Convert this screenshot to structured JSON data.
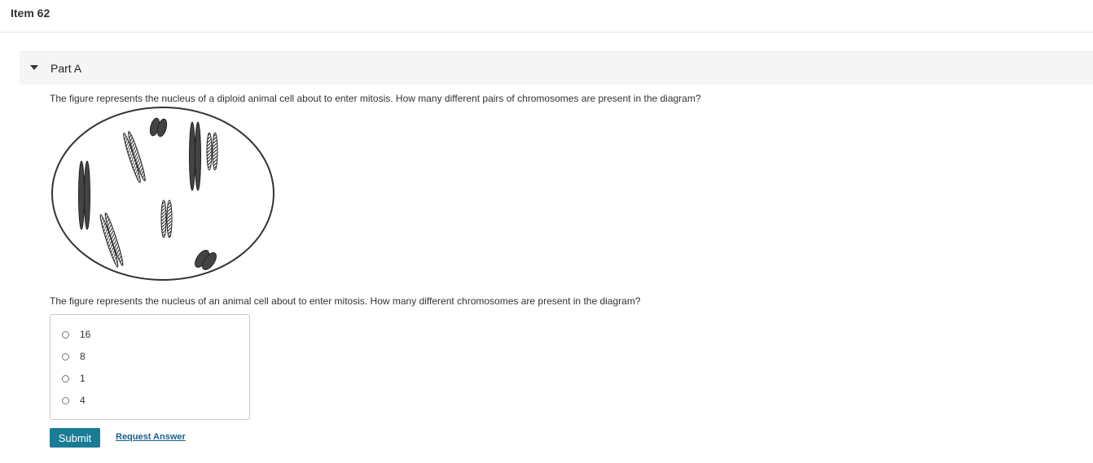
{
  "item": {
    "title": "Item 62"
  },
  "part": {
    "label": "Part A"
  },
  "question": {
    "text1": "The figure represents the nucleus of a diploid animal cell about to enter mitosis. How many different pairs of chromosomes are present in the diagram?",
    "text2": "The figure represents the nucleus of an animal cell about to enter mitosis. How many different chromosomes are present in the diagram?"
  },
  "choices": [
    {
      "label": "16",
      "selected": false
    },
    {
      "label": "8",
      "selected": false
    },
    {
      "label": "1",
      "selected": false
    },
    {
      "label": "4",
      "selected": false
    }
  ],
  "actions": {
    "submit_label": "Submit",
    "request_label": "Request Answer"
  },
  "colors": {
    "accent": "#1a7b94",
    "link": "#1a5f8a",
    "header_bg": "#f5f5f5"
  }
}
